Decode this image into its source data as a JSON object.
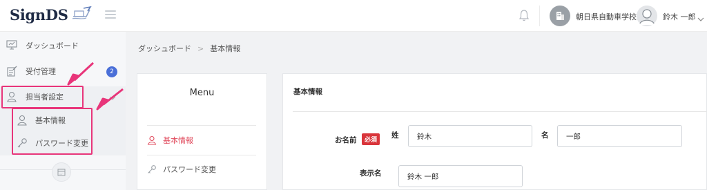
{
  "app": {
    "logo_text": "SignDS"
  },
  "header": {
    "school_name": "朝日県自動車学校",
    "user_name": "鈴木 一郎"
  },
  "sidebar": {
    "items": [
      {
        "label": "ダッシュボード",
        "icon": "monitor-icon"
      },
      {
        "label": "受付管理",
        "icon": "clipboard-icon",
        "badge": "2"
      },
      {
        "label": "担当者設定",
        "icon": "user-icon"
      }
    ],
    "sub_items": [
      {
        "label": "基本情報",
        "icon": "user-icon"
      },
      {
        "label": "パスワード変更",
        "icon": "key-icon"
      }
    ]
  },
  "breadcrumb": {
    "items": [
      "ダッシュボード",
      "基本情報"
    ],
    "separator": ">"
  },
  "menu_card": {
    "title": "Menu",
    "items": [
      {
        "label": "基本情報",
        "active": true
      },
      {
        "label": "パスワード変更",
        "active": false
      }
    ]
  },
  "form": {
    "heading": "基本情報",
    "name_label": "お名前",
    "required_badge": "必須",
    "sei_label": "姓",
    "sei_value": "鈴木",
    "mei_label": "名",
    "mei_value": "一郎",
    "display_label": "表示名",
    "display_value": "鈴木 一郎"
  },
  "colors": {
    "accent": "#e04a5c",
    "highlight": "#e8357a",
    "badge": "#4a6fd8",
    "required": "#d9353b"
  }
}
